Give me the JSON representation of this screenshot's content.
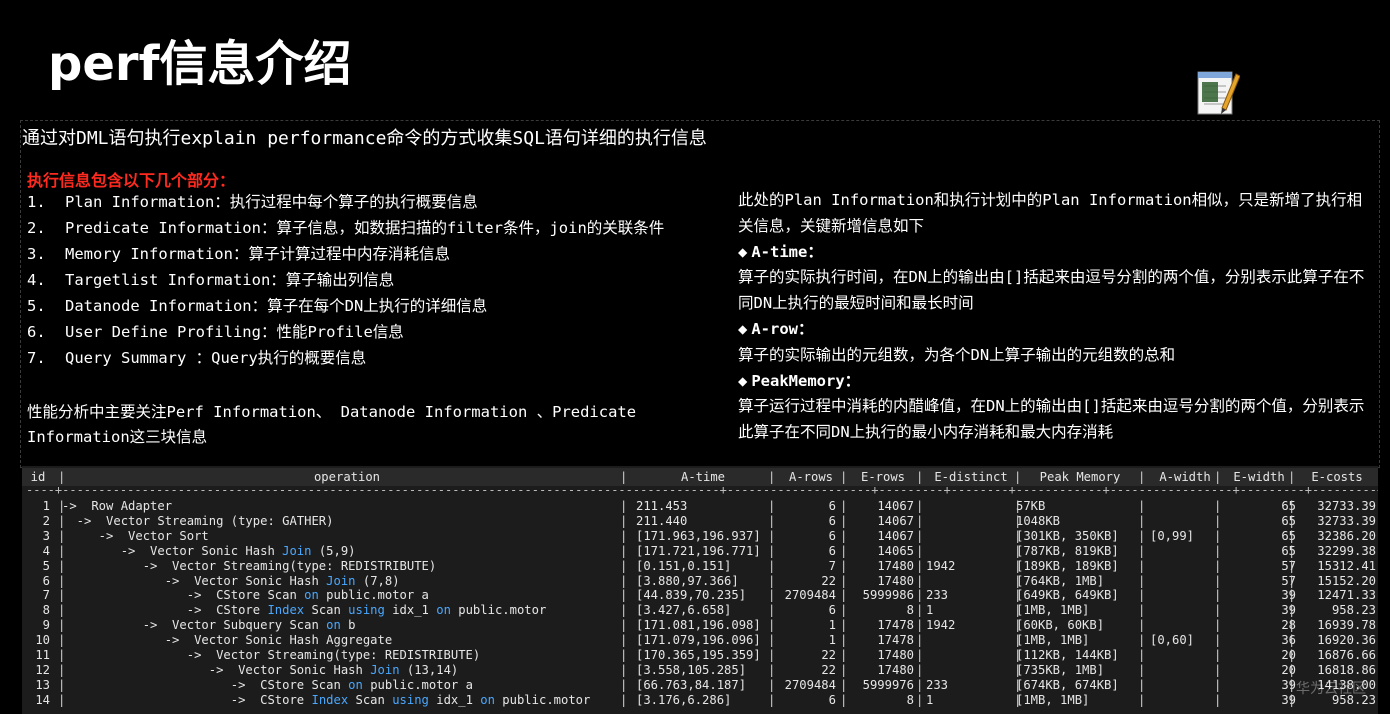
{
  "title": "perf信息介绍",
  "intro": "通过对DML语句执行explain performance命令的方式收集SQL语句详细的执行信息",
  "exec_heading": "执行信息包含以下几个部分：",
  "sections": [
    {
      "num": "1.",
      "text": "Plan Information：执行过程中每个算子的执行概要信息"
    },
    {
      "num": "2.",
      "text": "Predicate Information：算子信息，如数据扫描的filter条件，join的关联条件"
    },
    {
      "num": "3.",
      "text": "Memory Information：算子计算过程中内存消耗信息"
    },
    {
      "num": "4.",
      "text": "Targetlist Information：算子输出列信息"
    },
    {
      "num": "5.",
      "text": "Datanode Information：算子在每个DN上执行的详细信息"
    },
    {
      "num": "6.",
      "text": "User Define Profiling：性能Profile信息"
    },
    {
      "num": "7.",
      "text": "Query Summary ：Query执行的概要信息"
    }
  ],
  "perf_note": "性能分析中主要关注Perf Information、 Datanode Information 、Predicate Information这三块信息",
  "right": {
    "intro": "此处的Plan Information和执行计划中的Plan Information相似，只是新增了执行相关信息，关键新增信息如下",
    "diamond": "◆",
    "items": [
      {
        "head": "A-time：",
        "body": "算子的实际执行时间，在DN上的输出由[]括起来由逗号分割的两个值，分别表示此算子在不同DN上执行的最短时间和最长时间"
      },
      {
        "head": "A-row：",
        "body": "算子的实际输出的元组数，为各个DN上算子输出的元组数的总和"
      },
      {
        "head": "PeakMemory：",
        "body": "算子运行过程中消耗的内醋峰值，在DN上的输出由[]括起来由逗号分割的两个值，分别表示此算子在不同DN上执行的最小内存消耗和最大内存消耗"
      }
    ]
  },
  "table": {
    "headers": [
      "id",
      "operation",
      "A-time",
      "A-rows",
      "E-rows",
      "E-distinct",
      "Peak Memory",
      "A-width",
      "E-width",
      "E-costs"
    ],
    "rows": [
      [
        "1",
        [
          [
            "",
            "->  Row Adapter"
          ]
        ],
        "211.453",
        "6",
        "14067",
        "",
        "57KB",
        "",
        "65",
        "32733.39"
      ],
      [
        "2",
        [
          [
            "",
            "  ->  Vector Streaming (type: GATHER)"
          ]
        ],
        "211.440",
        "6",
        "14067",
        "",
        "1048KB",
        "",
        "65",
        "32733.39"
      ],
      [
        "3",
        [
          [
            "",
            "     ->  Vector Sort"
          ]
        ],
        "[171.963,196.937]",
        "6",
        "14067",
        "",
        "[301KB, 350KB]",
        "[0,99]",
        "65",
        "32386.20"
      ],
      [
        "4",
        [
          [
            "",
            "        ->  Vector Sonic Hash "
          ],
          [
            "kw",
            "Join"
          ],
          [
            "",
            " (5,9)"
          ]
        ],
        "[171.721,196.771]",
        "6",
        "14065",
        "",
        "[787KB, 819KB]",
        "",
        "65",
        "32299.38"
      ],
      [
        "5",
        [
          [
            "",
            "           ->  Vector Streaming(type: REDISTRIBUTE)"
          ]
        ],
        "[0.151,0.151]",
        "7",
        "17480",
        "1942",
        "[189KB, 189KB]",
        "",
        "57",
        "15312.41"
      ],
      [
        "6",
        [
          [
            "",
            "              ->  Vector Sonic Hash "
          ],
          [
            "kw",
            "Join"
          ],
          [
            "",
            " (7,8)"
          ]
        ],
        "[3.880,97.366]",
        "22",
        "17480",
        "",
        "[764KB, 1MB]",
        "",
        "57",
        "15152.20"
      ],
      [
        "7",
        [
          [
            "",
            "                 ->  CStore Scan "
          ],
          [
            "kw",
            "on"
          ],
          [
            "",
            " public.motor a"
          ]
        ],
        "[44.839,70.235]",
        "2709484",
        "5999986",
        "233",
        "[649KB, 649KB]",
        "",
        "39",
        "12471.33"
      ],
      [
        "8",
        [
          [
            "",
            "                 ->  CStore "
          ],
          [
            "kw",
            "Index"
          ],
          [
            "",
            " Scan "
          ],
          [
            "kw",
            "using"
          ],
          [
            "",
            " idx_1 "
          ],
          [
            "kw",
            "on"
          ],
          [
            "",
            " public.motor"
          ]
        ],
        "[3.427,6.658]",
        "6",
        "8",
        "1",
        "[1MB, 1MB]",
        "",
        "39",
        "958.23"
      ],
      [
        "9",
        [
          [
            "",
            "           ->  Vector Subquery Scan "
          ],
          [
            "kw",
            "on"
          ],
          [
            "",
            " b"
          ]
        ],
        "[171.081,196.098]",
        "1",
        "17478",
        "1942",
        "[60KB, 60KB]",
        "",
        "28",
        "16939.78"
      ],
      [
        "10",
        [
          [
            "",
            "              ->  Vector Sonic Hash Aggregate"
          ]
        ],
        "[171.079,196.096]",
        "1",
        "17478",
        "",
        "[1MB, 1MB]",
        "[0,60]",
        "36",
        "16920.36"
      ],
      [
        "11",
        [
          [
            "",
            "                 ->  Vector Streaming(type: REDISTRIBUTE)"
          ]
        ],
        "[170.365,195.359]",
        "22",
        "17480",
        "",
        "[112KB, 144KB]",
        "",
        "20",
        "16876.66"
      ],
      [
        "12",
        [
          [
            "",
            "                    ->  Vector Sonic Hash "
          ],
          [
            "kw",
            "Join"
          ],
          [
            "",
            " (13,14)"
          ]
        ],
        "[3.558,105.285]",
        "22",
        "17480",
        "",
        "[735KB, 1MB]",
        "",
        "20",
        "16818.86"
      ],
      [
        "13",
        [
          [
            "",
            "                       ->  CStore Scan "
          ],
          [
            "kw",
            "on"
          ],
          [
            "",
            " public.motor a"
          ]
        ],
        "[66.763,84.187]",
        "2709484",
        "5999976",
        "233",
        "[674KB, 674KB]",
        "",
        "39",
        "14138.00"
      ],
      [
        "14",
        [
          [
            "",
            "                       ->  CStore "
          ],
          [
            "kw",
            "Index"
          ],
          [
            "",
            " Scan "
          ],
          [
            "kw",
            "using"
          ],
          [
            "",
            " idx_1 "
          ],
          [
            "kw",
            "on"
          ],
          [
            "",
            " public.motor"
          ]
        ],
        "[3.176,6.286]",
        "6",
        "8",
        "1",
        "[1MB, 1MB]",
        "",
        "39",
        "958.23"
      ]
    ]
  },
  "watermark": "华为云社区",
  "icon": "notepad-pencil-icon"
}
